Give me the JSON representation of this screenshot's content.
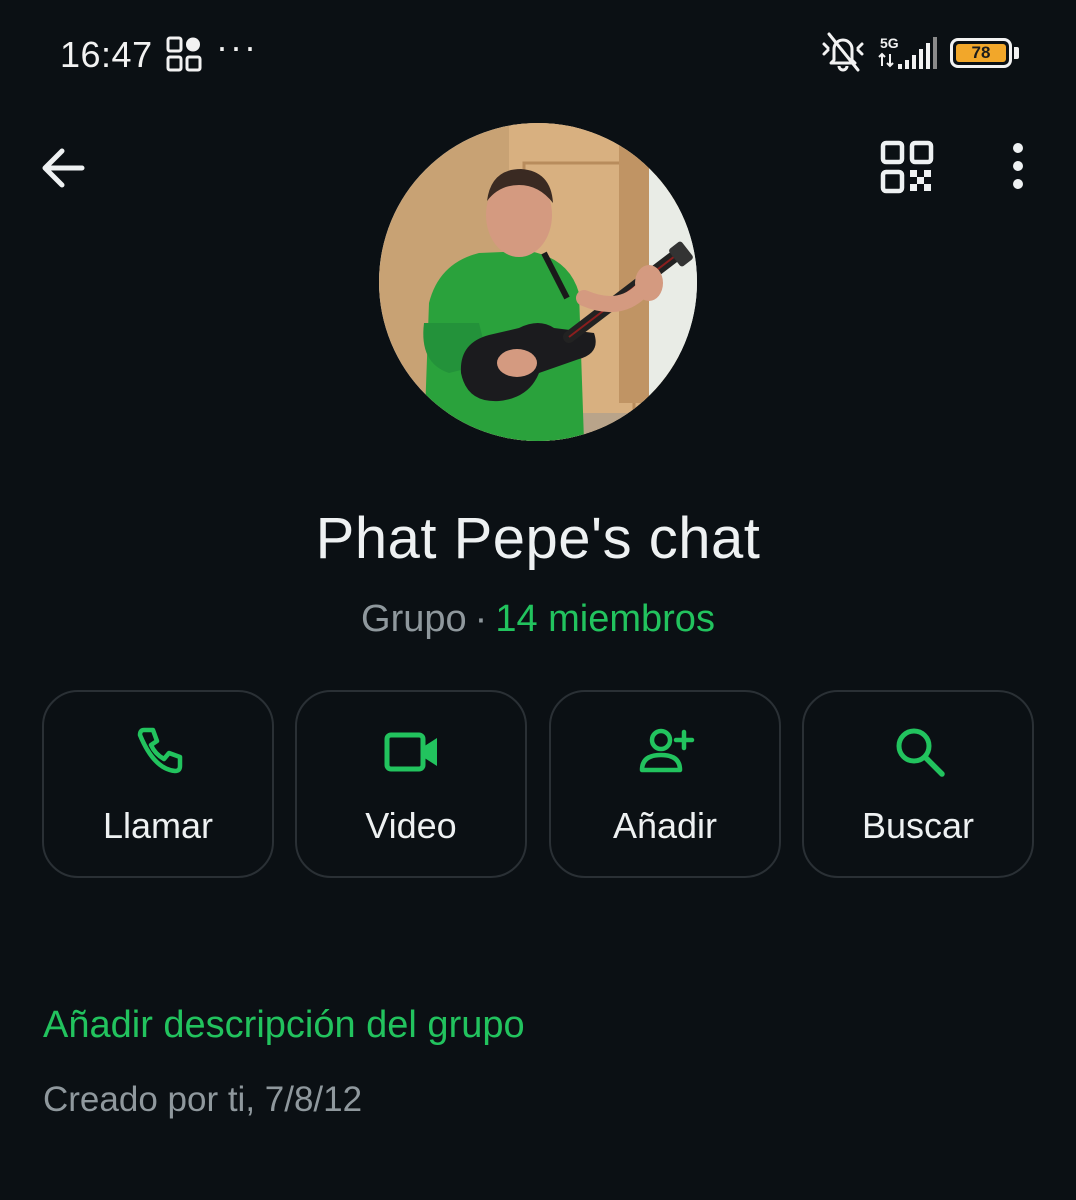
{
  "status_bar": {
    "time": "16:47",
    "dots": "···",
    "network": "5G",
    "battery": "78",
    "icons": [
      "apps-icon",
      "mute-icon",
      "signal-icon",
      "battery-icon"
    ]
  },
  "app_bar": {
    "back_icon": "arrow-left-icon",
    "qr_icon": "qr-code-icon",
    "menu_icon": "more-vertical-icon"
  },
  "group": {
    "name": "Phat Pepe's chat",
    "type": "Grupo",
    "separator": "·",
    "members": "14 miembros"
  },
  "actions": [
    {
      "label": "Llamar",
      "icon": "phone-icon"
    },
    {
      "label": "Video",
      "icon": "video-camera-icon"
    },
    {
      "label": "Añadir",
      "icon": "add-person-icon"
    },
    {
      "label": "Buscar",
      "icon": "search-icon"
    }
  ],
  "description": {
    "add_label": "Añadir descripción del grupo",
    "created": "Creado por ti, 7/8/12"
  },
  "colors": {
    "background": "#0b1014",
    "accent": "#22c35e",
    "text_primary": "#eef1f2",
    "text_secondary": "#8f989d",
    "button_border": "#2a3035",
    "battery": "#f2a72a"
  }
}
